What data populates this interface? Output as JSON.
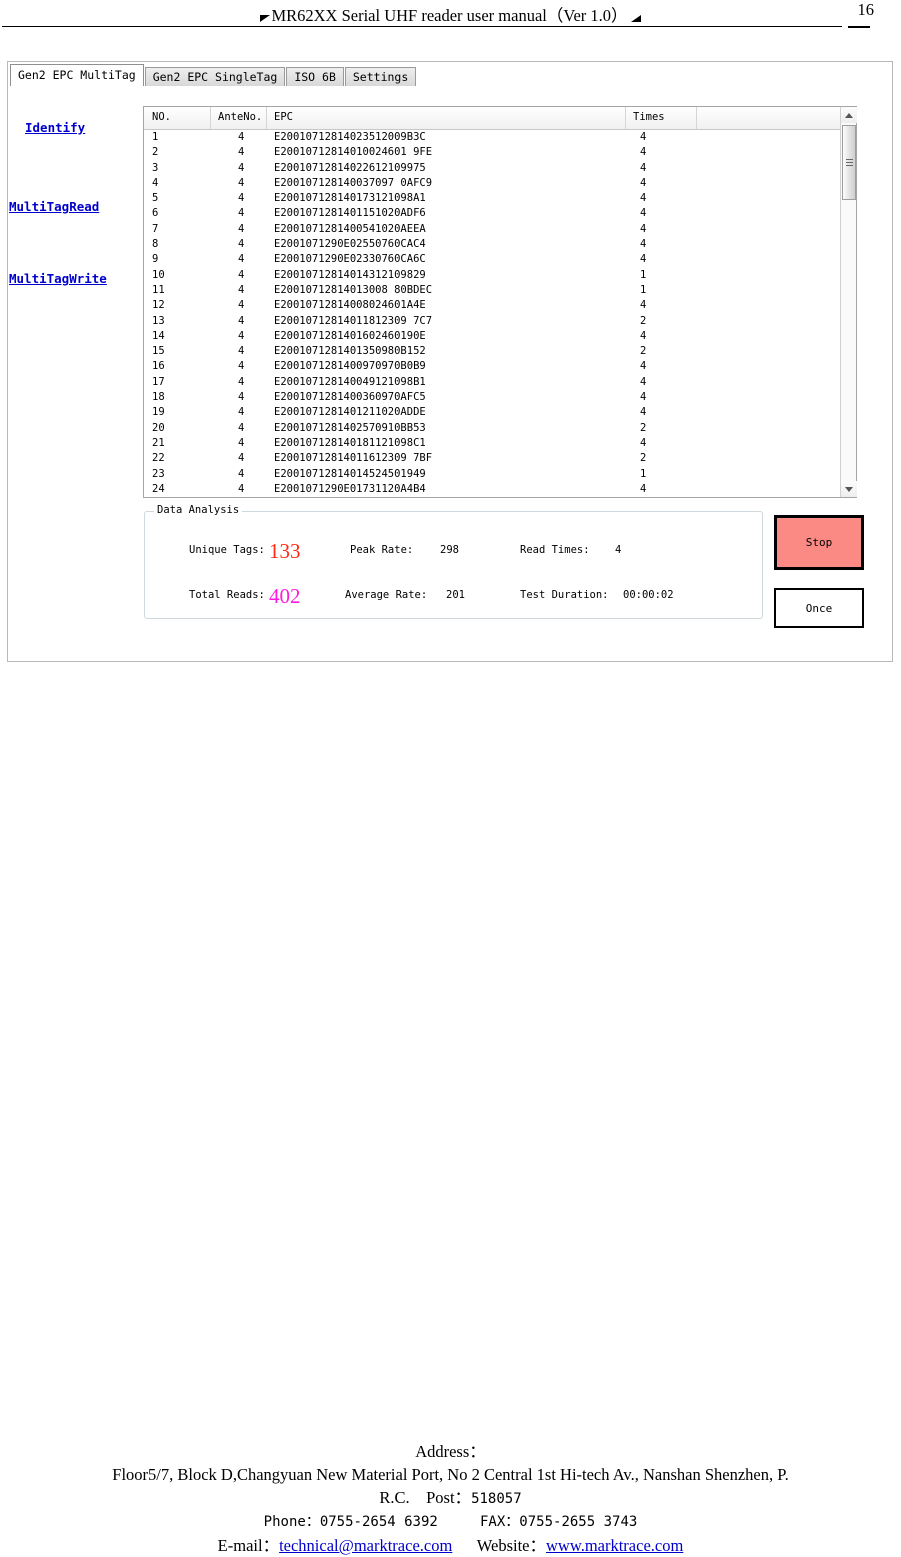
{
  "page": {
    "header_title": "MR62XX Serial UHF reader user manual（Ver 1.0）",
    "page_number": "16"
  },
  "window": {
    "tabs": [
      {
        "label": "Gen2 EPC MultiTag",
        "active": true
      },
      {
        "label": "Gen2 EPC SingleTag",
        "active": false
      },
      {
        "label": "ISO 6B",
        "active": false
      },
      {
        "label": "Settings",
        "active": false
      }
    ],
    "nav_links": [
      {
        "label": "Identify"
      },
      {
        "label": "MultiTagRead"
      },
      {
        "label": "MultiTagWrite"
      }
    ],
    "grid": {
      "columns": [
        "NO.",
        "AnteNo.",
        "EPC",
        "Times"
      ],
      "rows": [
        {
          "no": "1",
          "ante": "4",
          "epc": "E20010712814023512009B3C",
          "times": "4"
        },
        {
          "no": "2",
          "ante": "4",
          "epc": "E20010712814010024601 9FE",
          "times": "4"
        },
        {
          "no": "3",
          "ante": "4",
          "epc": "E20010712814022612109975",
          "times": "4"
        },
        {
          "no": "4",
          "ante": "4",
          "epc": "E200107128140037097 0AFC9",
          "times": "4"
        },
        {
          "no": "5",
          "ante": "4",
          "epc": "E200107128140173121098A1",
          "times": "4"
        },
        {
          "no": "6",
          "ante": "4",
          "epc": "E2001071281401151020ADF6",
          "times": "4"
        },
        {
          "no": "7",
          "ante": "4",
          "epc": "E2001071281400541020AEEA",
          "times": "4"
        },
        {
          "no": "8",
          "ante": "4",
          "epc": "E2001071290E02550760CAC4",
          "times": "4"
        },
        {
          "no": "9",
          "ante": "4",
          "epc": "E2001071290E02330760CA6C",
          "times": "4"
        },
        {
          "no": "10",
          "ante": "4",
          "epc": "E20010712814014312109829",
          "times": "1"
        },
        {
          "no": "11",
          "ante": "4",
          "epc": "E20010712814013008 80BDEC",
          "times": "1"
        },
        {
          "no": "12",
          "ante": "4",
          "epc": "E20010712814008024601A4E",
          "times": "4"
        },
        {
          "no": "13",
          "ante": "4",
          "epc": "E20010712814011812309 7C7",
          "times": "2"
        },
        {
          "no": "14",
          "ante": "4",
          "epc": "E2001071281401602460190E",
          "times": "4"
        },
        {
          "no": "15",
          "ante": "4",
          "epc": "E2001071281401350980B152",
          "times": "2"
        },
        {
          "no": "16",
          "ante": "4",
          "epc": "E2001071281400970970B0B9",
          "times": "4"
        },
        {
          "no": "17",
          "ante": "4",
          "epc": "E200107128140049121098B1",
          "times": "4"
        },
        {
          "no": "18",
          "ante": "4",
          "epc": "E2001071281400360970AFC5",
          "times": "4"
        },
        {
          "no": "19",
          "ante": "4",
          "epc": "E2001071281401211020ADDE",
          "times": "4"
        },
        {
          "no": "20",
          "ante": "4",
          "epc": "E2001071281402570910BB53",
          "times": "2"
        },
        {
          "no": "21",
          "ante": "4",
          "epc": "E200107128140181121098C1",
          "times": "4"
        },
        {
          "no": "22",
          "ante": "4",
          "epc": "E20010712814011612309 7BF",
          "times": "2"
        },
        {
          "no": "23",
          "ante": "4",
          "epc": "E20010712814014524501949",
          "times": "1"
        },
        {
          "no": "24",
          "ante": "4",
          "epc": "E2001071290E01731120A4B4",
          "times": "4"
        }
      ]
    },
    "analysis": {
      "legend": "Data Analysis",
      "unique_tags_label": "Unique Tags:",
      "unique_tags_value": "133",
      "peak_rate_label": "Peak Rate:",
      "peak_rate_value": "298",
      "read_times_label": "Read Times:",
      "read_times_value": "4",
      "total_reads_label": "Total Reads:",
      "total_reads_value": "402",
      "average_rate_label": "Average Rate:",
      "average_rate_value": "201",
      "test_duration_label": "Test Duration:",
      "test_duration_value": "00:00:02",
      "unique_tags_color": "#ff2a12",
      "total_reads_color": "#ff1ae0"
    },
    "buttons": {
      "stop_label": "Stop",
      "stop_color": "#fa8a83",
      "once_label": "Once"
    }
  },
  "footer": {
    "address_label": "Address：",
    "address_line": "Floor5/7, Block D,Changyuan New  Material Port, No 2 Central 1st Hi-tech Av., Nanshan Shenzhen, P.",
    "address_line2_a": "R.C.",
    "post_label": "Post：",
    "post_value": "518057",
    "phone_label": "Phone：",
    "phone_value": "0755-2654 6392",
    "fax_label": "FAX：",
    "fax_value": "0755-2655 3743",
    "email_label": "E-mail：",
    "email_value": "technical@marktrace.com",
    "website_label": "Website：",
    "website_value": "www.marktrace.com"
  }
}
